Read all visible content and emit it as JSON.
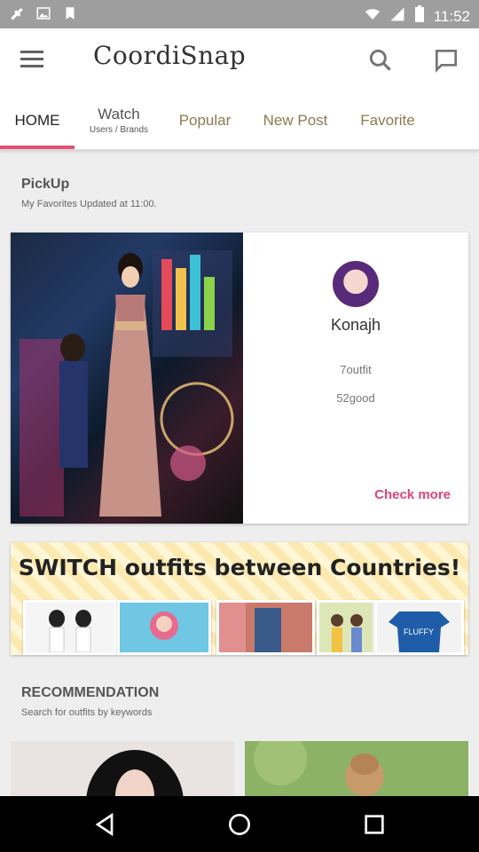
{
  "status_bar": {
    "time": "11:52"
  },
  "app": {
    "title": "CoordiSnap"
  },
  "tabs": [
    {
      "label": "HOME",
      "sub": ""
    },
    {
      "label": "Watch",
      "sub": "Users / Brands"
    },
    {
      "label": "Popular",
      "sub": ""
    },
    {
      "label": "New Post",
      "sub": ""
    },
    {
      "label": "Favorite",
      "sub": ""
    }
  ],
  "pickup": {
    "title": "PickUp",
    "subtitle": "My Favorites Updated at 11:00.",
    "username": "Konajh",
    "outfits": "7outfit",
    "good": "52good",
    "check_more": "Check more"
  },
  "banner": {
    "text": "SWITCH outfits between Countries!",
    "thumb_label": "FLUFFY"
  },
  "recommendation": {
    "title": "RECOMMENDATION",
    "subtitle": "Search for outfits by keywords"
  },
  "colors": {
    "accent": "#e05275",
    "tab_text": "#8a7b4f",
    "check_more": "#e0457a"
  },
  "icons": [
    "menu-icon",
    "search-icon",
    "message-icon",
    "back-icon",
    "home-icon",
    "recents-icon"
  ]
}
